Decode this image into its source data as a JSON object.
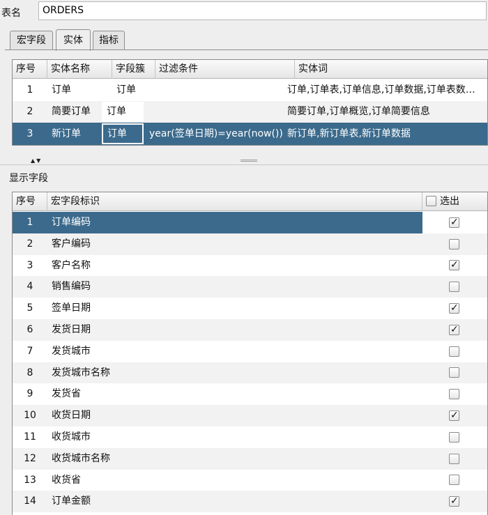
{
  "table_name": {
    "label": "表名",
    "value": "ORDERS"
  },
  "tabs": [
    {
      "label": "宏字段",
      "active": false
    },
    {
      "label": "实体",
      "active": true
    },
    {
      "label": "指标",
      "active": false
    }
  ],
  "entity_table": {
    "columns": [
      "序号",
      "实体名称",
      "字段簇",
      "过滤条件",
      "实体词"
    ],
    "rows": [
      {
        "seq": "1",
        "name": "订单",
        "field_group": "订单",
        "filter": "",
        "words": "订单,订单表,订单信息,订单数据,订单表数…"
      },
      {
        "seq": "2",
        "name": "简要订单",
        "field_group": "订单",
        "filter": "",
        "words": "简要订单,订单概览,订单简要信息"
      },
      {
        "seq": "3",
        "name": "新订单",
        "field_group": "订单",
        "filter": "year(签单日期)=year(now())",
        "words": "新订单,新订单表,新订单数据"
      }
    ],
    "selected_row": 3
  },
  "splitter": {
    "arrows": "▲▼"
  },
  "display_fields": {
    "section_label": "显示字段",
    "columns": {
      "seq": "序号",
      "field": "宏字段标识",
      "select": "选出"
    },
    "select_all_checked": false,
    "rows": [
      {
        "seq": "1",
        "field": "订单编码",
        "checked": true
      },
      {
        "seq": "2",
        "field": "客户编码",
        "checked": false
      },
      {
        "seq": "3",
        "field": "客户名称",
        "checked": true
      },
      {
        "seq": "4",
        "field": "销售编码",
        "checked": false
      },
      {
        "seq": "5",
        "field": "签单日期",
        "checked": true
      },
      {
        "seq": "6",
        "field": "发货日期",
        "checked": true
      },
      {
        "seq": "7",
        "field": "发货城市",
        "checked": false
      },
      {
        "seq": "8",
        "field": "发货城市名称",
        "checked": false
      },
      {
        "seq": "9",
        "field": "发货省",
        "checked": false
      },
      {
        "seq": "10",
        "field": "收货日期",
        "checked": true
      },
      {
        "seq": "11",
        "field": "收货城市",
        "checked": false
      },
      {
        "seq": "12",
        "field": "收货城市名称",
        "checked": false
      },
      {
        "seq": "13",
        "field": "收货省",
        "checked": false
      },
      {
        "seq": "14",
        "field": "订单金额",
        "checked": true
      }
    ],
    "selected_row": 1
  },
  "colors": {
    "selection": "#3b6a8c",
    "alt_row": "#f2f2f2",
    "background": "#eeeeee"
  }
}
